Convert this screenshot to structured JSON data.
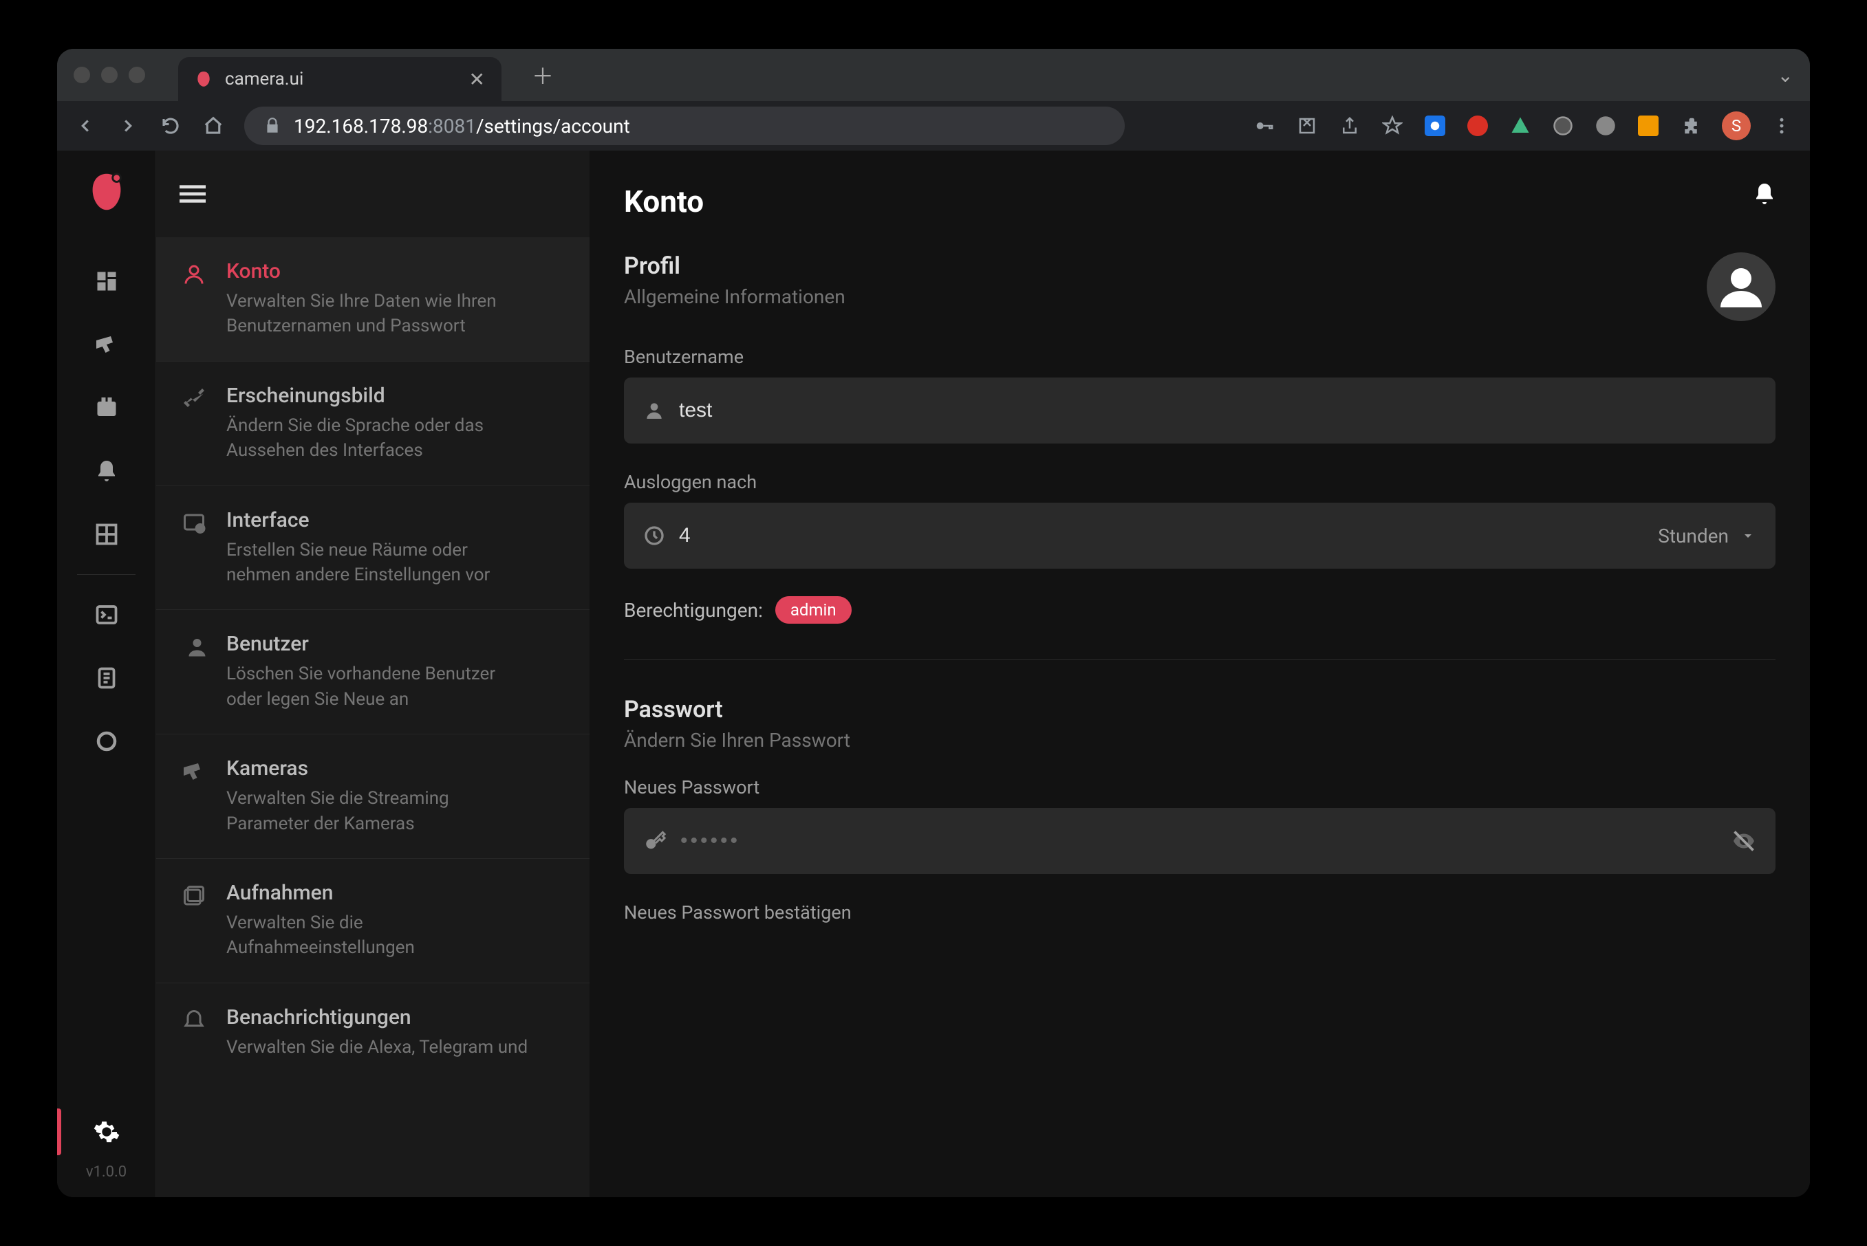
{
  "browser": {
    "tab_title": "camera.ui",
    "url_host": "192.168.178.98",
    "url_port": ":8081",
    "url_path": "/settings/account",
    "avatar_letter": "S"
  },
  "rail": {
    "version": "v1.0.0"
  },
  "subsidebar": {
    "items": [
      {
        "title": "Konto",
        "desc": "Verwalten Sie Ihre Daten wie Ihren Benutzernamen und Passwort"
      },
      {
        "title": "Erscheinungsbild",
        "desc": "Ändern Sie die Sprache oder das Aussehen des Interfaces"
      },
      {
        "title": "Interface",
        "desc": "Erstellen Sie neue Räume oder nehmen andere Einstellungen vor"
      },
      {
        "title": "Benutzer",
        "desc": "Löschen Sie vorhandene Benutzer oder legen Sie Neue an"
      },
      {
        "title": "Kameras",
        "desc": "Verwalten Sie die Streaming Parameter der Kameras"
      },
      {
        "title": "Aufnahmen",
        "desc": "Verwalten Sie die Aufnahmeeinstellungen"
      },
      {
        "title": "Benachrichtigungen",
        "desc": "Verwalten Sie die Alexa, Telegram und"
      }
    ]
  },
  "main": {
    "h1": "Konto",
    "profile_h2": "Profil",
    "profile_sub": "Allgemeine Informationen",
    "username_label": "Benutzername",
    "username_value": "test",
    "logout_label": "Ausloggen nach",
    "logout_value": "4",
    "logout_unit": "Stunden",
    "perm_label": "Berechtigungen:",
    "perm_value": "admin",
    "password_h2": "Passwort",
    "password_sub": "Ändern Sie Ihren Passwort",
    "newpass_label": "Neues Passwort",
    "newpass_placeholder": "••••••",
    "confirm_label": "Neues Passwort bestätigen"
  }
}
